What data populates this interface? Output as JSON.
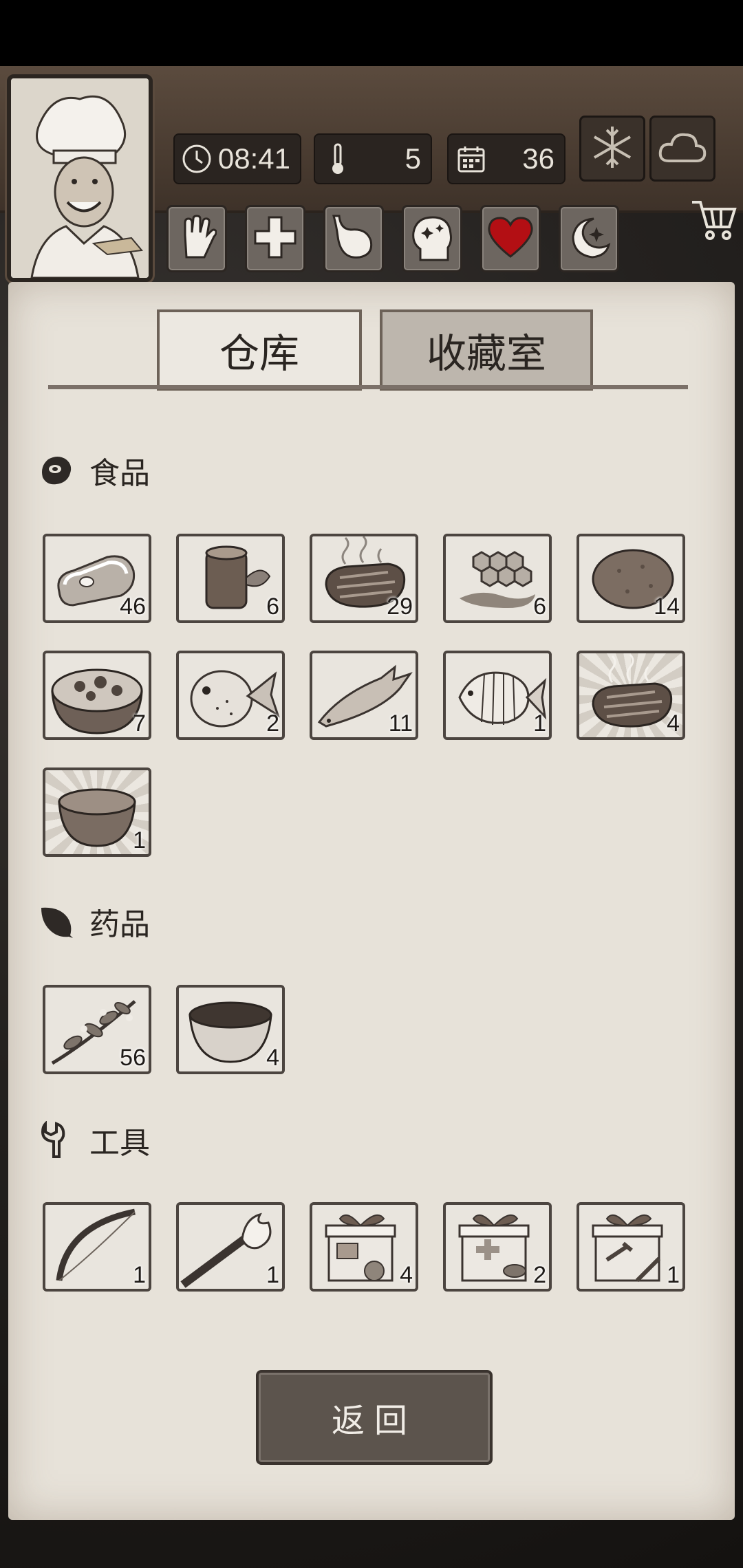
{
  "header": {
    "time": "08:41",
    "temperature": "5",
    "day": "36"
  },
  "tabs": [
    {
      "label": "仓库",
      "active": true
    },
    {
      "label": "收藏室",
      "active": false
    }
  ],
  "sections": [
    {
      "title": "食品",
      "icon": "meat-icon",
      "items": [
        {
          "name": "raw-meat",
          "count": "46"
        },
        {
          "name": "log-with-leaf",
          "count": "6"
        },
        {
          "name": "grilled-steak",
          "count": "29"
        },
        {
          "name": "honeycomb",
          "count": "6"
        },
        {
          "name": "potato",
          "count": "14"
        },
        {
          "name": "salad-bowl",
          "count": "7"
        },
        {
          "name": "pufferfish",
          "count": "2"
        },
        {
          "name": "salmon",
          "count": "11"
        },
        {
          "name": "tropical-fish",
          "count": "1"
        },
        {
          "name": "grilled-steak-rare",
          "count": "4"
        },
        {
          "name": "soup-bowl-rare",
          "count": "1"
        }
      ]
    },
    {
      "title": "药品",
      "icon": "leaf-icon",
      "items": [
        {
          "name": "herb-branch",
          "count": "56"
        },
        {
          "name": "medicine-bowl",
          "count": "4"
        }
      ]
    },
    {
      "title": "工具",
      "icon": "wrench-icon",
      "items": [
        {
          "name": "bow",
          "count": "1"
        },
        {
          "name": "torch",
          "count": "1"
        },
        {
          "name": "food-gift-box",
          "count": "4"
        },
        {
          "name": "medicine-gift-box",
          "count": "2"
        },
        {
          "name": "tool-gift-box",
          "count": "1"
        }
      ]
    }
  ],
  "back_button": "返回"
}
